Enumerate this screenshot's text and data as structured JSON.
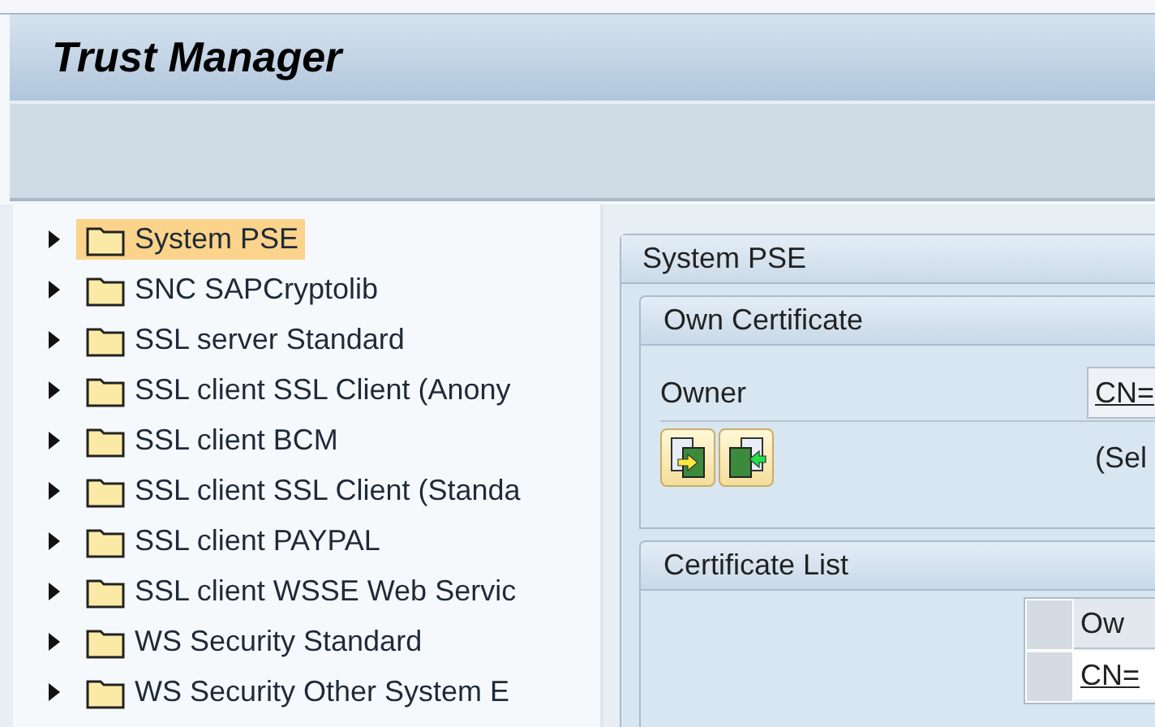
{
  "window": {
    "title": "Trust Manager"
  },
  "tree": {
    "items": [
      {
        "label": "System PSE",
        "selected": true,
        "expanded": false
      },
      {
        "label": "SNC SAPCryptolib",
        "selected": false,
        "expanded": false
      },
      {
        "label": "SSL server Standard",
        "selected": false,
        "expanded": false
      },
      {
        "label": "SSL client SSL Client (Anony",
        "selected": false,
        "expanded": false
      },
      {
        "label": "SSL client BCM",
        "selected": false,
        "expanded": false
      },
      {
        "label": "SSL client SSL Client (Standa",
        "selected": false,
        "expanded": false
      },
      {
        "label": "SSL client PAYPAL",
        "selected": false,
        "expanded": false
      },
      {
        "label": "SSL client WSSE Web Servic",
        "selected": false,
        "expanded": false
      },
      {
        "label": "WS Security Standard",
        "selected": false,
        "expanded": false
      },
      {
        "label": "WS Security Other System E",
        "selected": false,
        "expanded": false
      }
    ]
  },
  "detail": {
    "title": "System PSE",
    "own_certificate": {
      "title": "Own Certificate",
      "owner_label": "Owner",
      "owner_value": "CN=",
      "note": "(Sel"
    },
    "certificate_list": {
      "title": "Certificate List",
      "columns": [
        "Ow"
      ],
      "rows": [
        [
          "CN="
        ]
      ]
    }
  }
}
